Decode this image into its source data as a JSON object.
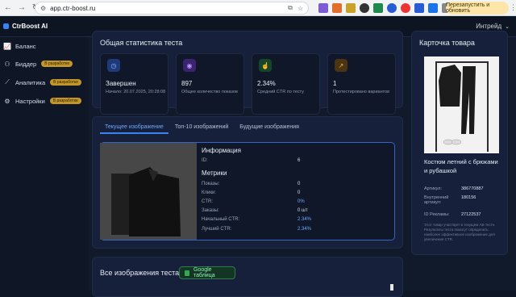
{
  "browser": {
    "url": "app.ctr-boost.ru",
    "update_button": "Перезапустить и обновить"
  },
  "app": {
    "logo": "CtrBoost AI",
    "user_menu": "Интрейд"
  },
  "sidebar": {
    "items": [
      {
        "label": "Баланс",
        "icon": "chart-line-icon"
      },
      {
        "label": "Биддер",
        "icon": "robot-icon",
        "badge": "В разработке"
      },
      {
        "label": "Аналитика",
        "icon": "analytics-icon",
        "badge": "В разработке"
      },
      {
        "label": "Настройки",
        "icon": "gear-icon",
        "badge": "В разработке"
      }
    ]
  },
  "stats": {
    "title": "Общая статистика теста",
    "cards": [
      {
        "value": "Завершен",
        "label": "Начало: 20.07.2025, 20:28:08",
        "icon": "clock-icon",
        "color": "#3b6fd6"
      },
      {
        "value": "897",
        "label": "Общее количество показов",
        "icon": "eye-icon",
        "color": "#7c3aed"
      },
      {
        "value": "2.34%",
        "label": "Средний CTR по тесту",
        "icon": "cursor-click-icon",
        "color": "#16a34a"
      },
      {
        "value": "1",
        "label": "Протестировано вариантов",
        "icon": "trend-icon",
        "color": "#b45309"
      }
    ]
  },
  "image_tabs": [
    {
      "label": "Текущее изображение",
      "active": true
    },
    {
      "label": "Топ-10 изображений",
      "active": false
    },
    {
      "label": "Будущие изображения",
      "active": false
    }
  ],
  "info": {
    "title": "Информация",
    "id_label": "ID:",
    "id_value": "6",
    "metrics_title": "Метрики",
    "rows": [
      {
        "label": "Показы:",
        "value": "0"
      },
      {
        "label": "Клики:",
        "value": "0"
      },
      {
        "label": "CTR:",
        "value": "0%"
      },
      {
        "label": "Заказы:",
        "value": "0 шт"
      },
      {
        "label": "Начальный CTR:",
        "value": "2.34%"
      },
      {
        "label": "Лучший CTR:",
        "value": "2.34%"
      }
    ]
  },
  "all_images": {
    "title": "Все изображения теста",
    "sheets_button": "Google таблица"
  },
  "product": {
    "title": "Карточка товара",
    "name": "Костюм летний с брюками и рубашкой",
    "rows": [
      {
        "label": "Артикул:",
        "value": "386770887"
      },
      {
        "label": "Внутренний артикул:",
        "value": "180156"
      },
      {
        "label": "ID Рекламы:",
        "value": "27122537"
      }
    ],
    "note": "Этот товар участвует в текущем АБ-тесте. Результаты теста помогут определить наиболее эффективное изображение для увеличения CTR."
  }
}
